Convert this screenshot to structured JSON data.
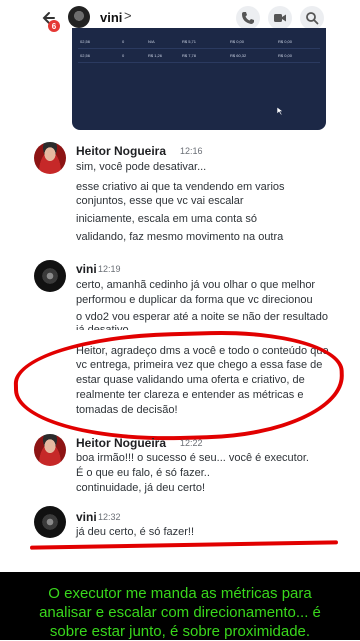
{
  "header": {
    "back_badge": "6",
    "channel_name": "vini",
    "chevron": ">"
  },
  "card": {
    "rows": [
      [
        "02,56",
        "0",
        "N/A",
        "R$ 5,71",
        "R$ 0,00",
        "R$ 0,00"
      ],
      [
        "02,56",
        "0",
        "R$ 1,26",
        "R$ 7,78",
        "R$ 60,32",
        "R$ 0,00"
      ]
    ]
  },
  "messages": [
    {
      "author": "Heitor Nogueira",
      "time": "12:16",
      "lines": [
        "sim, você pode desativar...",
        "esse criativo ai que ta vendendo em varios",
        "conjuntos, esse que vc vai escalar",
        "iniciamente, escala em uma conta só",
        "validando, faz mesmo movimento na outra"
      ]
    },
    {
      "author": "vini",
      "time": "12:19",
      "lines": [
        "certo, amanhã cedinho já vou olhar o que melhor",
        "performou e duplicar da forma que vc direcionou",
        "o vdo2 vou esperar até a noite se não der resultado",
        "já desativo",
        "Heitor, agradeço dms a você e todo o conteúdo que",
        "vc entrega, primeira vez que chego a essa fase de",
        "estar quase validando uma oferta e criativo, de",
        "realmente ter clareza e entender as métricas e",
        "tomadas de decisão!"
      ]
    },
    {
      "author": "Heitor Nogueira",
      "time": "12:22",
      "lines": [
        "boa irmão!!! o sucesso é seu... você é executor.",
        "É o que eu falo, é só fazer..",
        "continuidade, já deu certo!"
      ]
    },
    {
      "author": "vini",
      "time": "12:32",
      "lines": [
        "já deu certo, é só fazer!!"
      ]
    }
  ],
  "caption": {
    "line1": "O executor me manda as métricas para",
    "line2": "analisar e escalar com direcionamento... é",
    "line3": "sobre estar junto, é sobre proximidade."
  },
  "colors": {
    "annotation": "#e10000",
    "caption_text": "#39d71c",
    "card_bg": "#1c2846"
  }
}
